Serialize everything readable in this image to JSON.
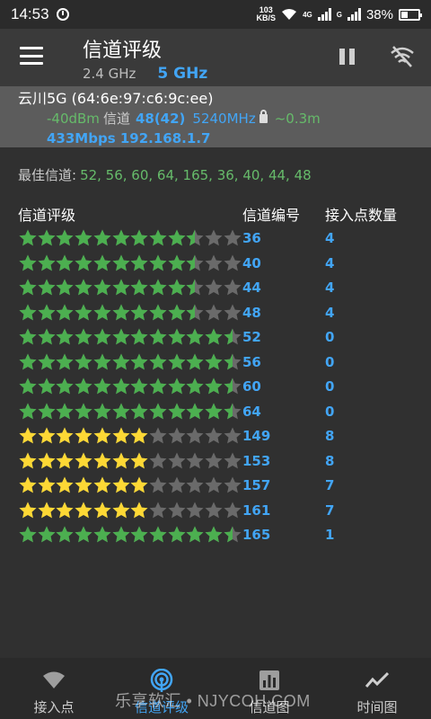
{
  "status_bar": {
    "time": "14:53",
    "net_speed_value": "103",
    "net_speed_unit": "KB/S",
    "signal_tag_1": "4G",
    "signal_tag_2": "G",
    "battery": "38%",
    "battery_level": 0.38
  },
  "app_bar": {
    "title": "信道评级",
    "tabs": [
      {
        "label": "2.4 GHz",
        "active": false
      },
      {
        "label": "5 GHz",
        "active": true
      }
    ],
    "pause_icon": "pause-icon",
    "wifi_off_icon": "wifi-off-icon"
  },
  "connected_ap": {
    "name": "云川5G (64:6e:97:c6:9c:ee)",
    "signal": "-40dBm",
    "channel_label": "信道",
    "channel": "48(42)",
    "frequency": "5240MHz",
    "distance": "~0.3m",
    "speed_ip": "433Mbps 192.168.1.7"
  },
  "best_channels": {
    "label": "最佳信道:",
    "values": "52, 56, 60, 64, 165, 36, 40, 44, 48"
  },
  "table": {
    "headers": {
      "rating": "信道评级",
      "channel": "信道编号",
      "ap_count": "接入点数量"
    },
    "rows": [
      {
        "channel": "36",
        "ap_count": "4",
        "rating": 9.5,
        "color": "green"
      },
      {
        "channel": "40",
        "ap_count": "4",
        "rating": 9.5,
        "color": "green"
      },
      {
        "channel": "44",
        "ap_count": "4",
        "rating": 9.5,
        "color": "green"
      },
      {
        "channel": "48",
        "ap_count": "4",
        "rating": 9.5,
        "color": "green"
      },
      {
        "channel": "52",
        "ap_count": "0",
        "rating": 11.5,
        "color": "green"
      },
      {
        "channel": "56",
        "ap_count": "0",
        "rating": 11.5,
        "color": "green"
      },
      {
        "channel": "60",
        "ap_count": "0",
        "rating": 11.5,
        "color": "green"
      },
      {
        "channel": "64",
        "ap_count": "0",
        "rating": 11.5,
        "color": "green"
      },
      {
        "channel": "149",
        "ap_count": "8",
        "rating": 7,
        "color": "yellow"
      },
      {
        "channel": "153",
        "ap_count": "8",
        "rating": 7,
        "color": "yellow"
      },
      {
        "channel": "157",
        "ap_count": "7",
        "rating": 7,
        "color": "yellow"
      },
      {
        "channel": "161",
        "ap_count": "7",
        "rating": 7,
        "color": "yellow"
      },
      {
        "channel": "165",
        "ap_count": "1",
        "rating": 11.5,
        "color": "green"
      }
    ],
    "max_stars": 12
  },
  "bottom_nav": [
    {
      "label": "接入点",
      "icon": "wifi-signal-icon",
      "active": false
    },
    {
      "label": "信道评级",
      "icon": "radar-icon",
      "active": true
    },
    {
      "label": "信道图",
      "icon": "bar-chart-icon",
      "active": false
    },
    {
      "label": "时间图",
      "icon": "line-chart-icon",
      "active": false
    }
  ],
  "watermark": "乐享软汇 • NJYCOH.COM",
  "colors": {
    "accent": "#42a5f5",
    "green": "#66bb6a",
    "star_green": "#4caf50",
    "star_yellow": "#fdd835",
    "star_empty": "#6a6a6a",
    "background": "#303030"
  }
}
